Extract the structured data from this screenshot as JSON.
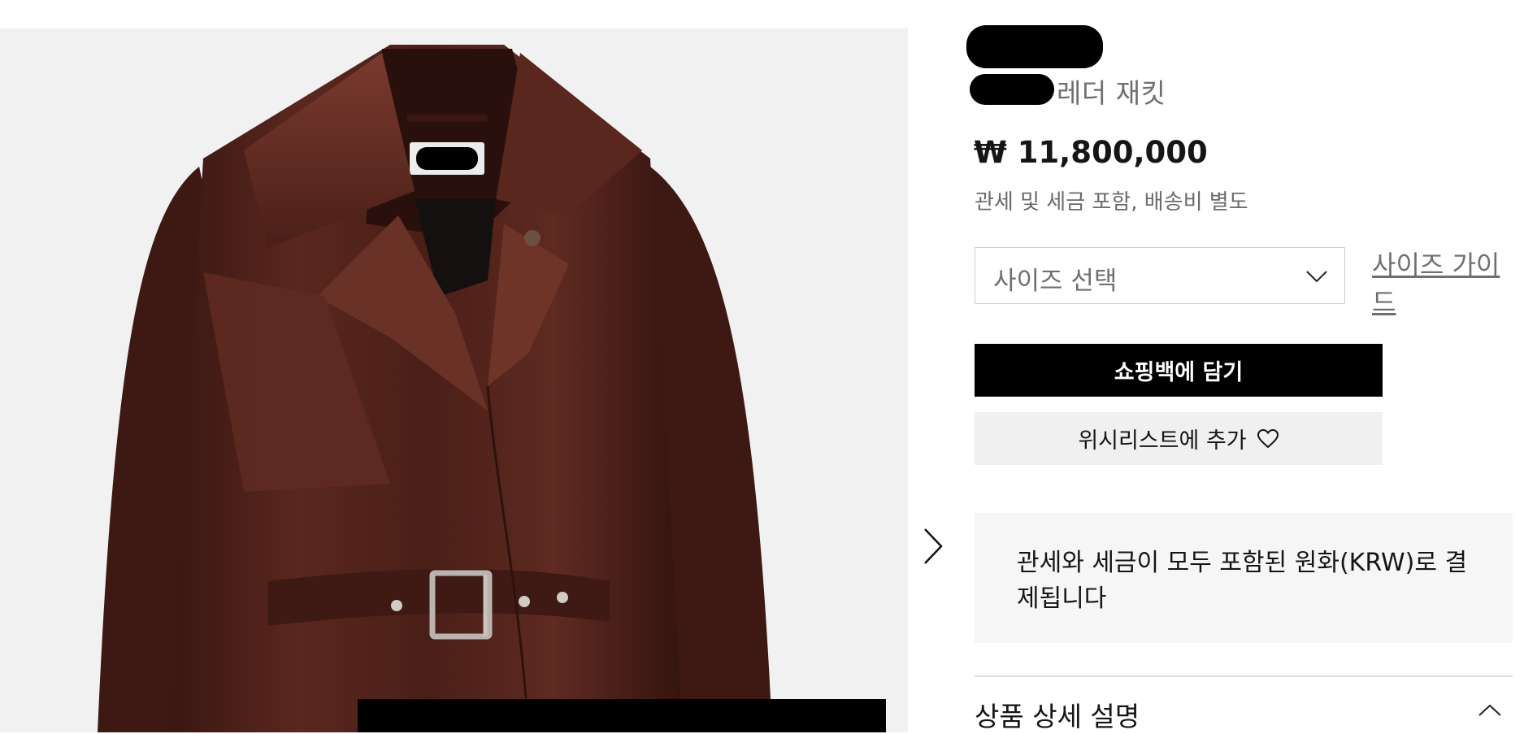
{
  "product": {
    "name": "레더 재킷",
    "price": "₩ 11,800,000",
    "tax_note": "관세 및 세금 포함, 배송비 별도"
  },
  "size": {
    "select_label": "사이즈 선택",
    "guide_link": "사이즈 가이드"
  },
  "actions": {
    "add_to_bag": "쇼핑백에 담기",
    "add_to_wishlist": "위시리스트에 추가"
  },
  "notice": {
    "krw_text": "관세와 세금이 모두 포함된 원화(KRW)로 결제됩니다"
  },
  "details": {
    "heading": "상품 상세 설명"
  },
  "icons": {
    "gallery_next": "chevron-right-icon",
    "select": "chevron-down-icon",
    "wishlist": "heart-outline-icon",
    "details_toggle": "chevron-up-icon"
  },
  "colors": {
    "leather": "#4a1f18",
    "image_background": "#f1f1f1",
    "primary_button": "#000000",
    "secondary_button": "#f0f0f0",
    "muted_text": "#6f6f6f"
  }
}
